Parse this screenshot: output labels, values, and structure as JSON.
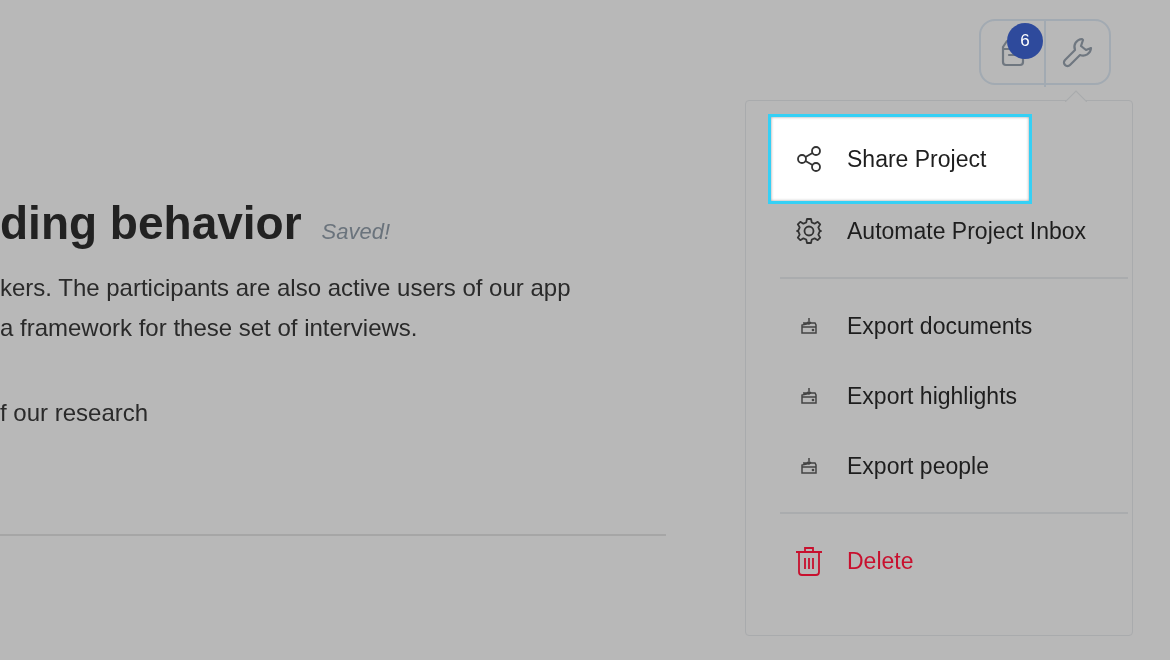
{
  "document": {
    "title": "ding behavior",
    "save_status": "Saved!",
    "paragraphs": [
      "kers. The participants are also active users of our app",
      "a framework for these set of interviews.",
      "f our research"
    ]
  },
  "toolbar": {
    "inbox_badge": "6"
  },
  "menu": {
    "sections": [
      {
        "items": [
          {
            "label": "Share Project",
            "kind": "share",
            "selected": true
          },
          {
            "label": "Automate Project Inbox",
            "kind": "settings",
            "selected": false
          }
        ]
      },
      {
        "items": [
          {
            "label": "Export documents",
            "kind": "export",
            "selected": false
          },
          {
            "label": "Export highlights",
            "kind": "export",
            "selected": false
          },
          {
            "label": "Export people",
            "kind": "export",
            "selected": false
          }
        ]
      },
      {
        "items": [
          {
            "label": "Delete",
            "kind": "delete",
            "selected": false
          }
        ]
      }
    ]
  }
}
